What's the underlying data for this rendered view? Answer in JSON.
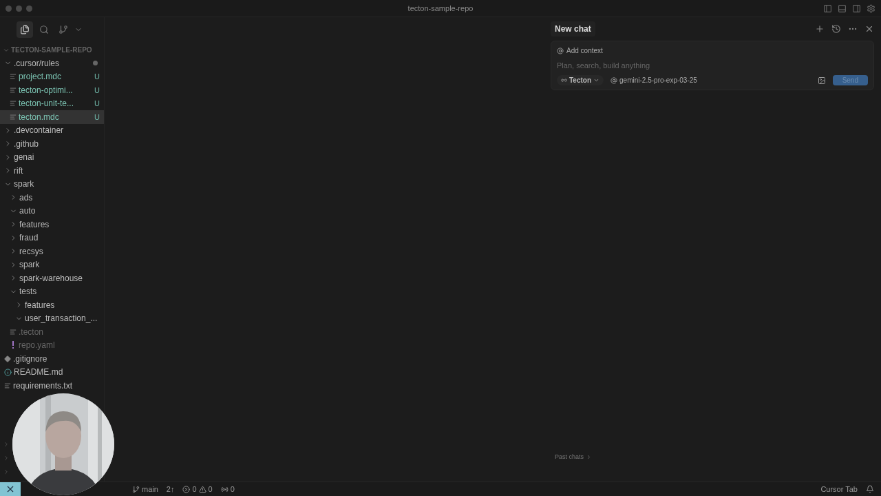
{
  "window": {
    "title": "tecton-sample-repo"
  },
  "activity_tabs": [
    {
      "kind": "files",
      "selected": true
    },
    {
      "kind": "search",
      "selected": false
    },
    {
      "kind": "git",
      "selected": false
    }
  ],
  "explorer": {
    "root": "TECTON-SAMPLE-REPO",
    "items": [
      {
        "name": ".cursor/rules",
        "kind": "folder",
        "expanded": true,
        "modified": true,
        "selected": false,
        "ignored": false,
        "children": [
          {
            "name": "project.mdc",
            "kind": "file",
            "status": "U",
            "selected": false,
            "ignored": false
          },
          {
            "name": "tecton-optimi...",
            "kind": "file",
            "status": "U",
            "selected": false,
            "ignored": false
          },
          {
            "name": "tecton-unit-te...",
            "kind": "file",
            "status": "U",
            "selected": false,
            "ignored": false
          },
          {
            "name": "tecton.mdc",
            "kind": "file",
            "status": "U",
            "selected": true,
            "ignored": false
          }
        ]
      },
      {
        "name": ".devcontainer",
        "kind": "folder",
        "expanded": false,
        "selected": false,
        "ignored": false
      },
      {
        "name": ".github",
        "kind": "folder",
        "expanded": false,
        "selected": false,
        "ignored": false
      },
      {
        "name": "genai",
        "kind": "folder",
        "expanded": false,
        "selected": false,
        "ignored": false
      },
      {
        "name": "rift",
        "kind": "folder",
        "expanded": false,
        "selected": false,
        "ignored": false
      },
      {
        "name": "spark",
        "kind": "folder",
        "expanded": true,
        "selected": false,
        "ignored": false,
        "children": [
          {
            "name": "ads",
            "kind": "folder",
            "expanded": false,
            "selected": false,
            "ignored": false
          },
          {
            "name": "auto",
            "kind": "folder",
            "expanded": true,
            "selected": false,
            "ignored": false
          },
          {
            "name": "features",
            "kind": "folder",
            "expanded": false,
            "selected": false,
            "ignored": false
          },
          {
            "name": "fraud",
            "kind": "folder",
            "expanded": false,
            "selected": false,
            "ignored": false
          },
          {
            "name": "recsys",
            "kind": "folder",
            "expanded": false,
            "selected": false,
            "ignored": false
          },
          {
            "name": "spark",
            "kind": "folder",
            "expanded": false,
            "selected": false,
            "ignored": false
          },
          {
            "name": "spark-warehouse",
            "kind": "folder",
            "expanded": false,
            "selected": false,
            "ignored": false
          },
          {
            "name": "tests",
            "kind": "folder",
            "expanded": true,
            "selected": false,
            "ignored": false,
            "children": [
              {
                "name": "features",
                "kind": "folder",
                "expanded": false,
                "selected": false,
                "ignored": false
              },
              {
                "name": "user_transaction_...",
                "kind": "folder",
                "expanded": true,
                "selected": false,
                "ignored": false
              }
            ]
          },
          {
            "name": ".tecton",
            "kind": "file",
            "selected": false,
            "ignored": true
          },
          {
            "name": "repo.yaml",
            "kind": "yaml",
            "selected": false,
            "ignored": true
          }
        ]
      },
      {
        "name": ".gitignore",
        "kind": "git",
        "selected": false,
        "ignored": false
      },
      {
        "name": "README.md",
        "kind": "info",
        "selected": false,
        "ignored": false
      },
      {
        "name": "requirements.txt",
        "kind": "file",
        "selected": false,
        "ignored": false
      }
    ]
  },
  "chat": {
    "tab": "New chat",
    "add_context": "Add context",
    "placeholder": "Plan, search, build anything",
    "agent": "Tecton",
    "model": "gemini-2.5-pro-exp-03-25",
    "send": "Send",
    "past_chats": "Past chats"
  },
  "status_bar": {
    "branch": "main",
    "sync": "2↑",
    "errors": "0",
    "warnings": "0",
    "ports": "0",
    "right": "Cursor Tab"
  }
}
